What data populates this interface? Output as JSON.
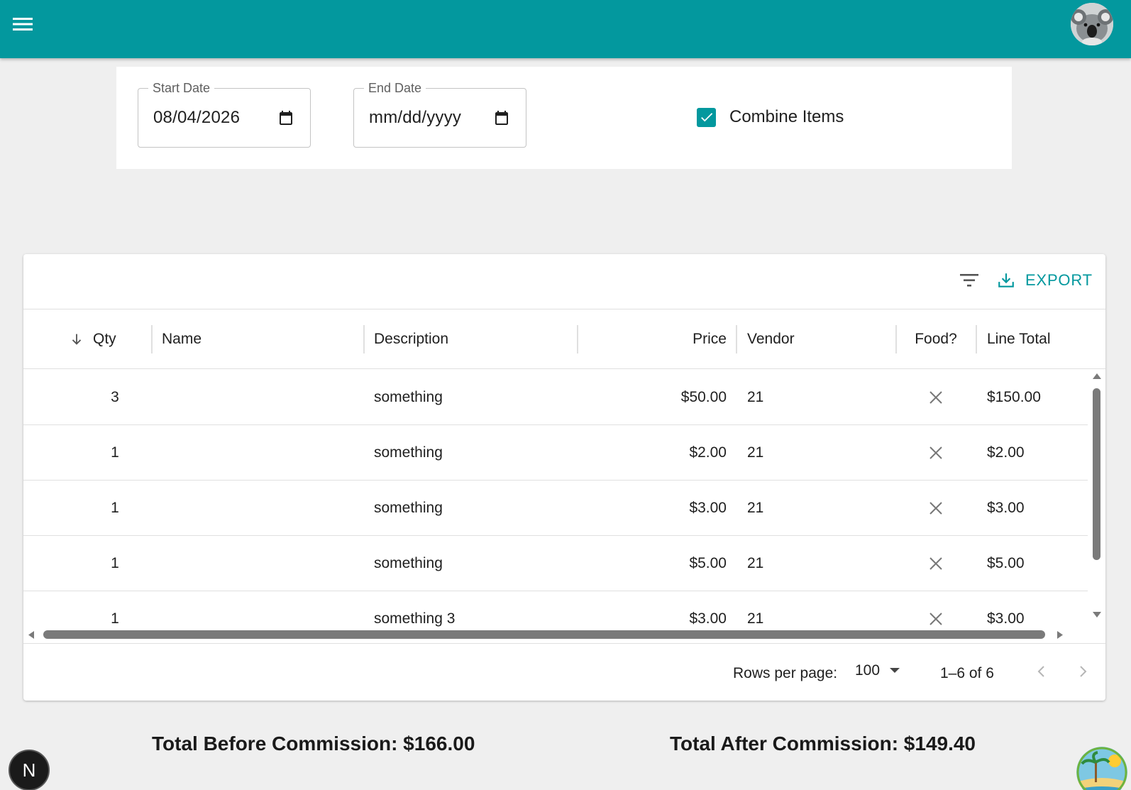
{
  "header": {
    "menu_icon": "menu-icon",
    "avatar_icon": "koala-avatar"
  },
  "filters": {
    "start_date": {
      "label": "Start Date",
      "value": "08/04/2026"
    },
    "end_date": {
      "label": "End Date",
      "value": "mm/dd/yyyy"
    },
    "combine_items": {
      "label": "Combine Items",
      "checked": true
    }
  },
  "toolbar": {
    "export_label": "EXPORT"
  },
  "table": {
    "columns": [
      "Qty",
      "Name",
      "Description",
      "Price",
      "Vendor",
      "Food?",
      "Line Total"
    ],
    "rows": [
      {
        "qty": "3",
        "name": "",
        "description": "something",
        "price": "$50.00",
        "vendor": "21",
        "food": "false",
        "line_total": "$150.00"
      },
      {
        "qty": "1",
        "name": "",
        "description": "something",
        "price": "$2.00",
        "vendor": "21",
        "food": "false",
        "line_total": "$2.00"
      },
      {
        "qty": "1",
        "name": "",
        "description": "something",
        "price": "$3.00",
        "vendor": "21",
        "food": "false",
        "line_total": "$3.00"
      },
      {
        "qty": "1",
        "name": "",
        "description": "something",
        "price": "$5.00",
        "vendor": "21",
        "food": "false",
        "line_total": "$5.00"
      },
      {
        "qty": "1",
        "name": "",
        "description": "something 3",
        "price": "$3.00",
        "vendor": "21",
        "food": "false",
        "line_total": "$3.00"
      }
    ]
  },
  "pagination": {
    "rows_per_page_label": "Rows per page:",
    "rows_per_page": "100",
    "range": "1–6 of 6"
  },
  "totals": {
    "before": "Total Before Commission: $166.00",
    "after": "Total After Commission: $149.40"
  },
  "badges": {
    "next_label": "N"
  },
  "colors": {
    "primary": "#03989e",
    "background": "#efefef"
  }
}
